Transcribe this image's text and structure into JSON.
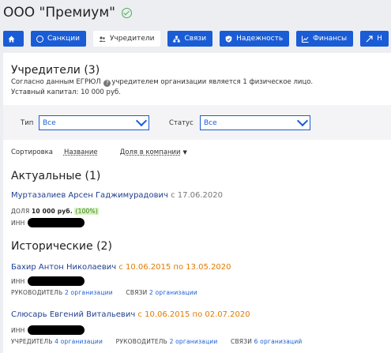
{
  "header": {
    "company": "ООО \"Премиум\""
  },
  "nav": {
    "items": [
      {
        "label": "",
        "icon": "home-icon"
      },
      {
        "label": "Санкции",
        "icon": "globe-icon"
      },
      {
        "label": "Учредители",
        "icon": "users-icon",
        "active": true
      },
      {
        "label": "Связи",
        "icon": "network-icon"
      },
      {
        "label": "Надежность",
        "icon": "shield-icon"
      },
      {
        "label": "Финансы",
        "icon": "chart-icon"
      },
      {
        "label": "Н",
        "icon": "more-icon"
      }
    ]
  },
  "founders": {
    "title": "Учредители (3)",
    "desc_before": "Согласно данным ЕГРЮЛ",
    "desc_after": "учредителем организации является 1 физическое лицо.",
    "capital": "Уставный капитал: 10 000 руб."
  },
  "filters": {
    "type_label": "Тип",
    "type_value": "Все",
    "status_label": "Статус",
    "status_value": "Все"
  },
  "sort": {
    "label": "Сортировка",
    "by_name": "Название",
    "by_share": "Доля в компании"
  },
  "actual": {
    "title": "Актуальные (1)",
    "person": {
      "name": "Муртазалиев Арсен Гаджимурадович",
      "dates": "с 17.06.2020",
      "share_label": "ДОЛЯ",
      "share_value": "10 000 руб.",
      "share_pct": "(100%)",
      "inn_label": "ИНН"
    }
  },
  "historical": {
    "title": "Исторические (2)",
    "people": [
      {
        "name": "Бахир Антон Николаевич",
        "dates": "с 10.06.2015 по 13.05.2020",
        "inn_label": "ИНН",
        "links": [
          {
            "label": "РУКОВОДИТЕЛЬ",
            "value": "2 организации"
          },
          {
            "label": "СВЯЗИ",
            "value": "2 организации"
          }
        ]
      },
      {
        "name": "Слюсарь Евгений Витальевич",
        "dates": "с 10.06.2015 по 02.07.2020",
        "inn_label": "ИНН",
        "links": [
          {
            "label": "УЧРЕДИТЕЛЬ",
            "value": "4 организации"
          },
          {
            "label": "РУКОВОДИТЕЛЬ",
            "value": "2 организации"
          },
          {
            "label": "СВЯЗИ",
            "value": "6 организаций"
          }
        ]
      }
    ]
  },
  "colors": {
    "accent": "#1a5cd6",
    "orange": "#e07b00",
    "green": "#4caf50"
  }
}
